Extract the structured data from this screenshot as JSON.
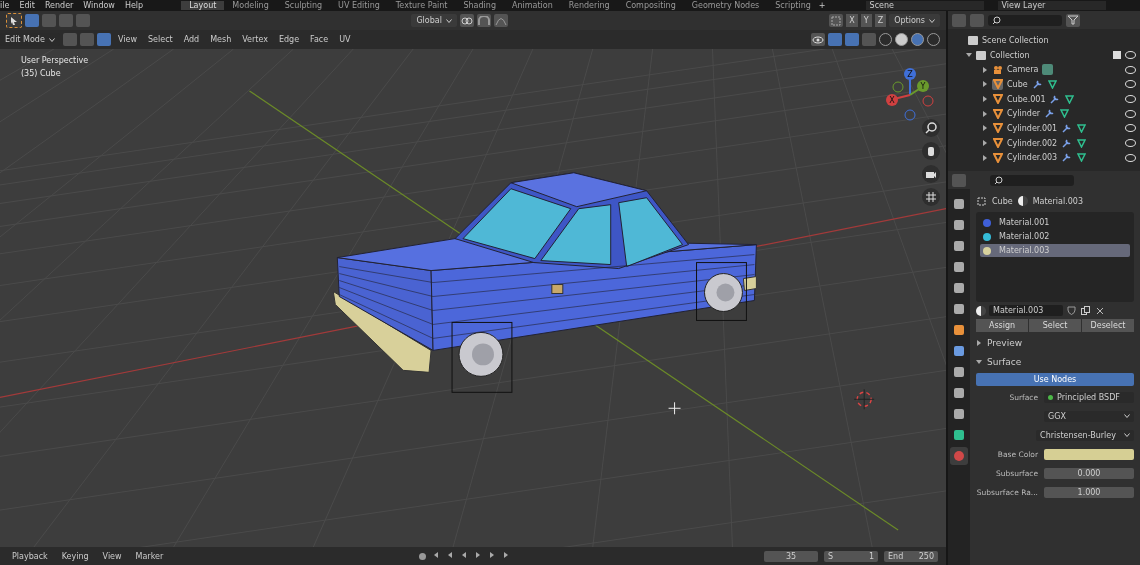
{
  "menu": [
    "ile",
    "Edit",
    "Render",
    "Window",
    "Help"
  ],
  "workspace_tabs": [
    {
      "label": "Layout",
      "selected": true
    },
    {
      "label": "Modeling",
      "selected": false
    },
    {
      "label": "Sculpting",
      "selected": false
    },
    {
      "label": "UV Editing",
      "selected": false
    },
    {
      "label": "Texture Paint",
      "selected": false
    },
    {
      "label": "Shading",
      "selected": false
    },
    {
      "label": "Animation",
      "selected": false
    },
    {
      "label": "Rendering",
      "selected": false
    },
    {
      "label": "Compositing",
      "selected": false
    },
    {
      "label": "Geometry Nodes",
      "selected": false
    },
    {
      "label": "Scripting",
      "selected": false
    }
  ],
  "add_tab": "+",
  "scene": "Scene",
  "view_layer": "View Layer",
  "tool_header": {
    "orientation": "Global",
    "axes": [
      "X",
      "Y",
      "Z"
    ],
    "options": "Options"
  },
  "view_header": {
    "mode": "Edit Mode",
    "menus": [
      "View",
      "Select",
      "Add",
      "Mesh",
      "Vertex",
      "Edge",
      "Face",
      "UV"
    ]
  },
  "viewport": {
    "view_name": "User Perspective",
    "object_info": "(35) Cube",
    "gizmo_axes": [
      "Z",
      "Y",
      "X"
    ]
  },
  "outliner": {
    "root": "Scene Collection",
    "collection": {
      "name": "Collection",
      "checked": true,
      "expanded": true
    },
    "items": [
      {
        "name": "Camera",
        "kind": "camera",
        "active": false
      },
      {
        "name": "Cube",
        "kind": "mesh",
        "active": true
      },
      {
        "name": "Cube.001",
        "kind": "mesh",
        "active": false
      },
      {
        "name": "Cylinder",
        "kind": "mesh",
        "active": false
      },
      {
        "name": "Cylinder.001",
        "kind": "mesh",
        "active": false
      },
      {
        "name": "Cylinder.002",
        "kind": "mesh",
        "active": false
      },
      {
        "name": "Cylinder.003",
        "kind": "mesh",
        "active": false
      }
    ]
  },
  "properties": {
    "object": "Cube",
    "material": "Material.003",
    "slots": [
      {
        "name": "Material.001",
        "color": "#3f5fd8",
        "selected": false
      },
      {
        "name": "Material.002",
        "color": "#35bcd8",
        "selected": false
      },
      {
        "name": "Material.003",
        "color": "#d8d29e",
        "selected": true
      }
    ],
    "material_field": "Material.003",
    "slot_buttons": [
      "Assign",
      "Select",
      "Deselect"
    ],
    "panels": [
      {
        "label": "Preview",
        "expanded": false
      },
      {
        "label": "Surface",
        "expanded": true
      }
    ],
    "use_nodes": "Use Nodes",
    "surface_label": "Surface",
    "surface_value": "Principled BSDF",
    "dropdowns": [
      "GGX",
      "Christensen-Burley"
    ],
    "inputs": [
      {
        "label": "Base Color",
        "kind": "color",
        "color": "#d6cf94"
      },
      {
        "label": "Subsurface",
        "kind": "number",
        "value": "0.000"
      },
      {
        "label": "Subsurface Ra...",
        "kind": "number",
        "value": "1.000"
      }
    ]
  },
  "timeline": {
    "menus": [
      "Playback",
      "Keying",
      "View",
      "Marker"
    ],
    "frame": "35",
    "start_label": "S",
    "start": "1",
    "end_label": "End",
    "end": "250"
  }
}
